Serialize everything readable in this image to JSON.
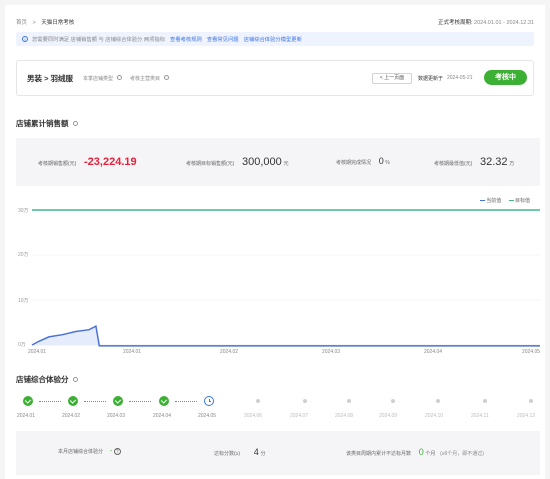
{
  "breadcrumb": {
    "home": "首页",
    "sep": ">",
    "current": "天猫日常考核"
  },
  "period": {
    "label": "正式考核周期:",
    "value": "2024.01.01 - 2024.12.31"
  },
  "notice": {
    "text": "您需要同时满足 店铺销售额 与 店铺综合体验分 两项指标",
    "links": [
      "查看考核规则",
      "查看常见问题",
      "店铺综合体验分模型更新"
    ]
  },
  "category": {
    "path": "男装 > 羽绒服",
    "store_type_label": "本季店铺类型",
    "review_label": "考核主营类目",
    "prev_button": "< 上一页面",
    "updated_label": "数据更新于",
    "updated_value": "2024-05-21",
    "status_button": "考核中"
  },
  "sales": {
    "title": "店铺累计销售额",
    "metrics": [
      {
        "label": "考核期销售额(元)",
        "value": "-23,224.19",
        "unit": ""
      },
      {
        "label": "考核期目标销售额(元)",
        "value": "300,000",
        "unit": "元"
      },
      {
        "label": "考核期完成情况",
        "value": "0",
        "unit": "%"
      },
      {
        "label": "考核期最低值(元)",
        "value": "32.32",
        "unit": "万"
      }
    ]
  },
  "chart_data": {
    "type": "line",
    "legend": [
      {
        "name": "当前值",
        "color": "#4a72d8"
      },
      {
        "name": "目标值",
        "color": "#3fb88f"
      }
    ],
    "y_ticks": [
      "30万",
      "20万",
      "10万",
      "0万"
    ],
    "x_ticks": [
      "2024.01",
      "2024.01",
      "2024.02",
      "2024.03",
      "2024.04",
      "2024.05"
    ],
    "ylim": [
      0,
      300000
    ],
    "target": 300000,
    "current_series": [
      {
        "x": "2024-01-01",
        "y": 0
      },
      {
        "x": "2024-01-03",
        "y": 8000
      },
      {
        "x": "2024-01-06",
        "y": 18000
      },
      {
        "x": "2024-01-10",
        "y": 23000
      },
      {
        "x": "2024-01-14",
        "y": 30000
      },
      {
        "x": "2024-01-18",
        "y": 34000
      },
      {
        "x": "2024-01-20",
        "y": 42000
      },
      {
        "x": "2024-01-21",
        "y": -2000
      },
      {
        "x": "2024-05-31",
        "y": -2000
      }
    ]
  },
  "experience": {
    "title": "店铺综合体验分",
    "months": [
      "2024.01",
      "2024.02",
      "2024.03",
      "2024.04",
      "2024.05",
      "2024.06",
      "2024.07",
      "2024.08",
      "2024.09",
      "2024.10",
      "2024.11",
      "2024.12"
    ],
    "done_count": 4,
    "current_index": 4,
    "summary": {
      "score_label": "本月店铺综合体验分",
      "score_value": "-",
      "target_label": "达标分数(≥)",
      "target_value": "4",
      "target_unit": "分",
      "months_label": "该类目周期内累计不达标月数",
      "months_value": "0",
      "months_unit": "个月",
      "months_note": "(≥6个月，即不通过)"
    }
  },
  "colors": {
    "accent": "#3d74e6",
    "green": "#3cb034",
    "red": "#e8213b"
  }
}
